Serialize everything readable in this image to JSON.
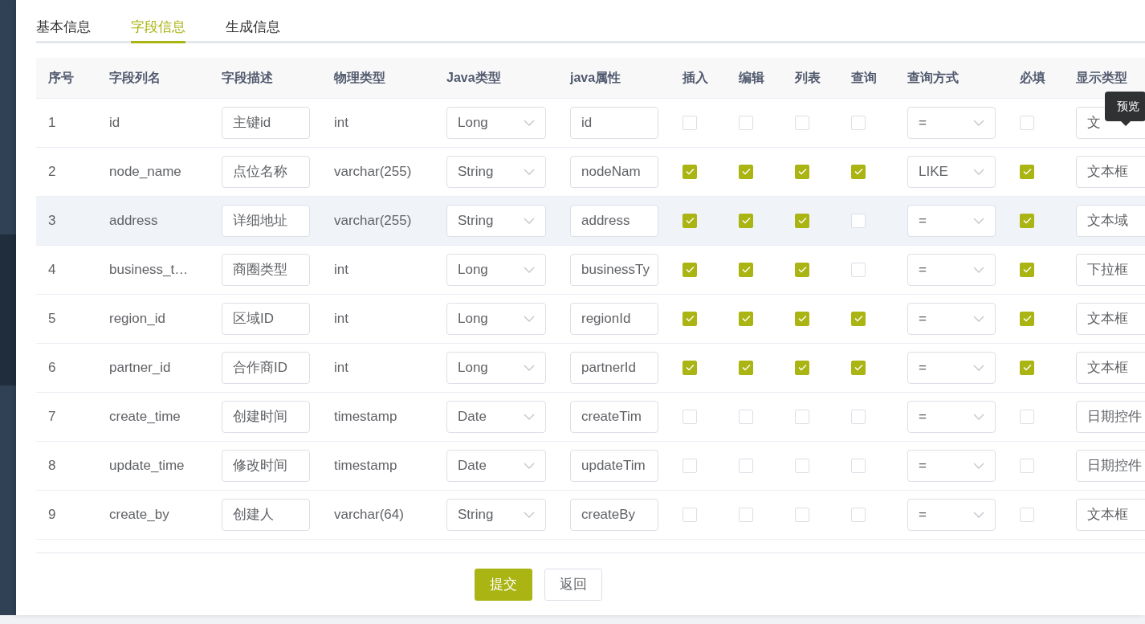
{
  "tabs": [
    {
      "label": "基本信息",
      "selected": false
    },
    {
      "label": "字段信息",
      "selected": true
    },
    {
      "label": "生成信息",
      "selected": false
    }
  ],
  "table": {
    "columns": [
      "序号",
      "字段列名",
      "字段描述",
      "物理类型",
      "Java类型",
      "java属性",
      "插入",
      "编辑",
      "列表",
      "查询",
      "查询方式",
      "必填",
      "显示类型"
    ],
    "rows": [
      {
        "index": "1",
        "column_name": "id",
        "description": "主键id",
        "physical_type": "int",
        "java_type": "Long",
        "java_field": "id",
        "insert": false,
        "edit": false,
        "list": false,
        "query": false,
        "query_type": "=",
        "required": false,
        "display_type": "文",
        "selected": false
      },
      {
        "index": "2",
        "column_name": "node_name",
        "description": "点位名称",
        "physical_type": "varchar(255)",
        "java_type": "String",
        "java_field": "nodeNam",
        "insert": true,
        "edit": true,
        "list": true,
        "query": true,
        "query_type": "LIKE",
        "required": true,
        "display_type": "文本框",
        "selected": false
      },
      {
        "index": "3",
        "column_name": "address",
        "description": "详细地址",
        "physical_type": "varchar(255)",
        "java_type": "String",
        "java_field": "address",
        "insert": true,
        "edit": true,
        "list": true,
        "query": false,
        "query_type": "=",
        "required": true,
        "display_type": "文本域",
        "selected": true
      },
      {
        "index": "4",
        "column_name": "business_t…",
        "description": "商圈类型",
        "physical_type": "int",
        "java_type": "Long",
        "java_field": "businessTy",
        "insert": true,
        "edit": true,
        "list": true,
        "query": false,
        "query_type": "=",
        "required": true,
        "display_type": "下拉框",
        "selected": false
      },
      {
        "index": "5",
        "column_name": "region_id",
        "description": "区域ID",
        "physical_type": "int",
        "java_type": "Long",
        "java_field": "regionId",
        "insert": true,
        "edit": true,
        "list": true,
        "query": true,
        "query_type": "=",
        "required": true,
        "display_type": "文本框",
        "selected": false
      },
      {
        "index": "6",
        "column_name": "partner_id",
        "description": "合作商ID",
        "physical_type": "int",
        "java_type": "Long",
        "java_field": "partnerId",
        "insert": true,
        "edit": true,
        "list": true,
        "query": true,
        "query_type": "=",
        "required": true,
        "display_type": "文本框",
        "selected": false
      },
      {
        "index": "7",
        "column_name": "create_time",
        "description": "创建时间",
        "physical_type": "timestamp",
        "java_type": "Date",
        "java_field": "createTim",
        "insert": false,
        "edit": false,
        "list": false,
        "query": false,
        "query_type": "=",
        "required": false,
        "display_type": "日期控件",
        "selected": false
      },
      {
        "index": "8",
        "column_name": "update_time",
        "description": "修改时间",
        "physical_type": "timestamp",
        "java_type": "Date",
        "java_field": "updateTim",
        "insert": false,
        "edit": false,
        "list": false,
        "query": false,
        "query_type": "=",
        "required": false,
        "display_type": "日期控件",
        "selected": false
      },
      {
        "index": "9",
        "column_name": "create_by",
        "description": "创建人",
        "physical_type": "varchar(64)",
        "java_type": "String",
        "java_field": "createBy",
        "insert": false,
        "edit": false,
        "list": false,
        "query": false,
        "query_type": "=",
        "required": false,
        "display_type": "文本框",
        "selected": false
      }
    ]
  },
  "tooltip": "预览",
  "buttons": [
    {
      "label": "提交",
      "kind": "primary"
    },
    {
      "label": "返回",
      "kind": "default"
    }
  ]
}
